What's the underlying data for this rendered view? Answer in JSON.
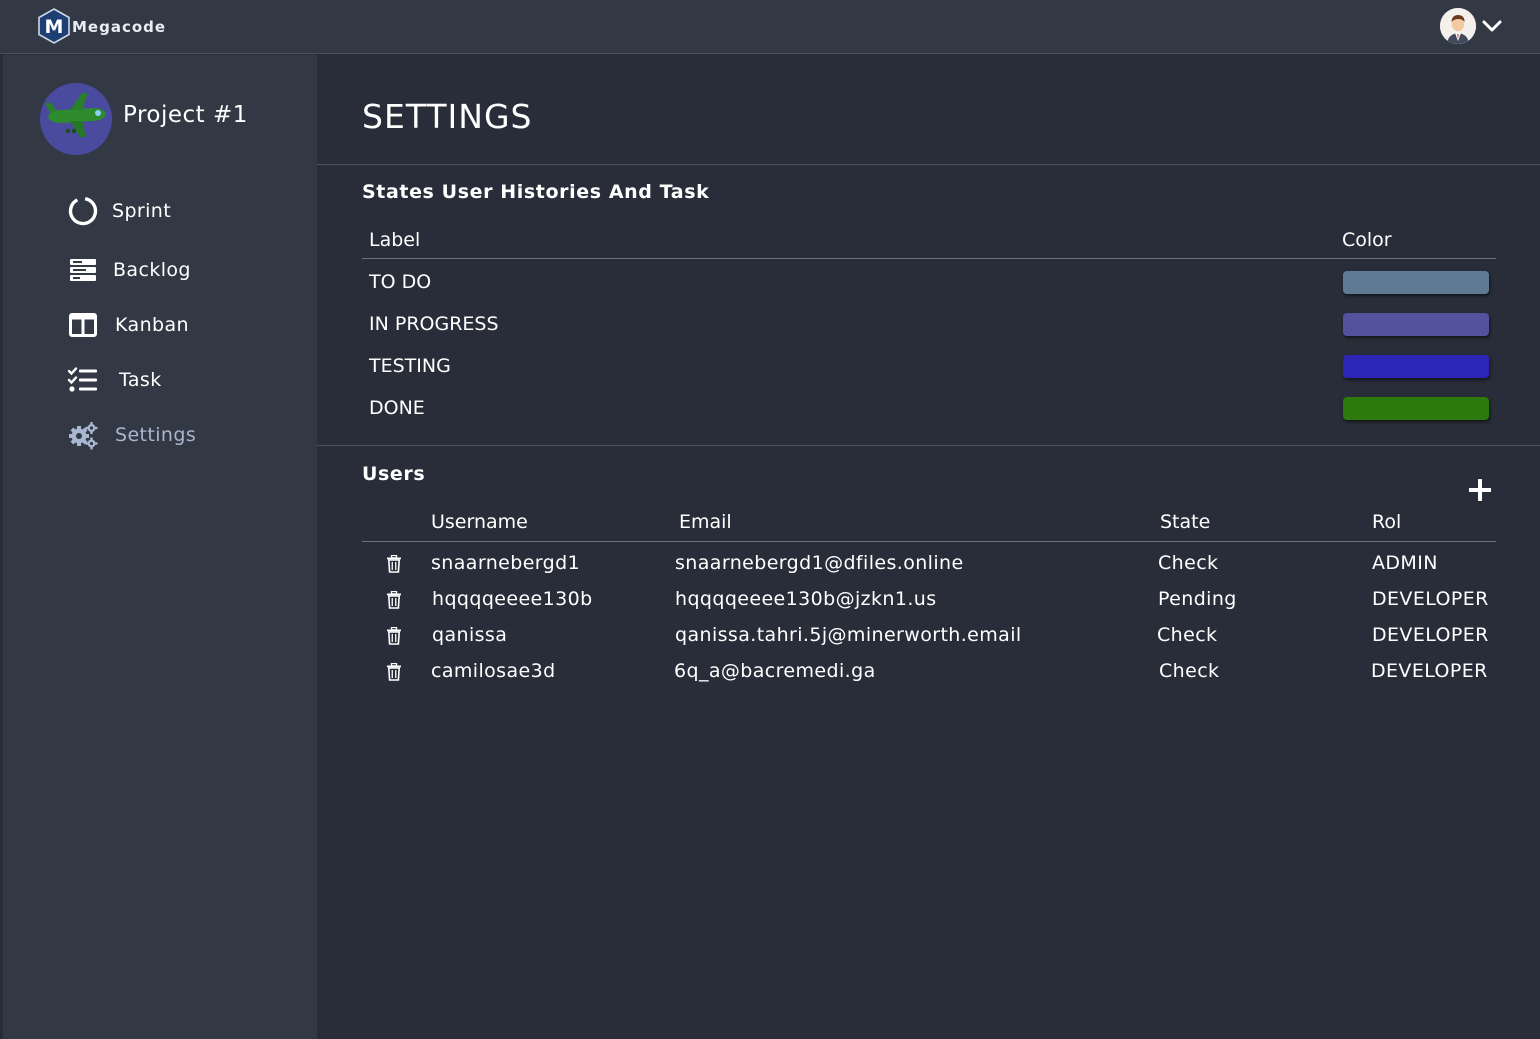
{
  "app": {
    "brand": "Megacode",
    "brand_initial": "M"
  },
  "sidebar": {
    "project_name": "Project #1",
    "items": [
      {
        "label": "Sprint",
        "icon": "circle-progress-icon"
      },
      {
        "label": "Backlog",
        "icon": "backlog-icon"
      },
      {
        "label": "Kanban",
        "icon": "kanban-icon"
      },
      {
        "label": "Task",
        "icon": "task-list-icon"
      },
      {
        "label": "Settings",
        "icon": "gears-icon",
        "active": true
      }
    ]
  },
  "page": {
    "title": "SETTINGS"
  },
  "states": {
    "title": "States User Histories And Task",
    "columns": {
      "label": "Label",
      "color": "Color"
    },
    "rows": [
      {
        "label": "TO DO",
        "color": "#5f7b93"
      },
      {
        "label": "IN PROGRESS",
        "color": "#52539c"
      },
      {
        "label": "TESTING",
        "color": "#2c25b6"
      },
      {
        "label": "DONE",
        "color": "#2b7a0b"
      }
    ]
  },
  "users": {
    "title": "Users",
    "columns": {
      "username": "Username",
      "email": "Email",
      "state": "State",
      "rol": "Rol"
    },
    "rows": [
      {
        "username": "snaarnebergd1",
        "email": "snaarnebergd1@dfiles.online",
        "state": "Check",
        "rol": "ADMIN"
      },
      {
        "username": "hqqqqeeee130b",
        "email": "hqqqqeeee130b@jzkn1.us",
        "state": "Pending",
        "rol": "DEVELOPER"
      },
      {
        "username": "qanissa",
        "email": "qanissa.tahri.5j@minerworth.email",
        "state": "Check",
        "rol": "DEVELOPER"
      },
      {
        "username": "camilosae3d",
        "email": "6q_a@bacremedi.ga",
        "state": "Check",
        "rol": "DEVELOPER"
      }
    ]
  },
  "colors": {
    "background": "#282d39",
    "sidebar": "#323844",
    "active_nav": "#a9b6cf"
  }
}
